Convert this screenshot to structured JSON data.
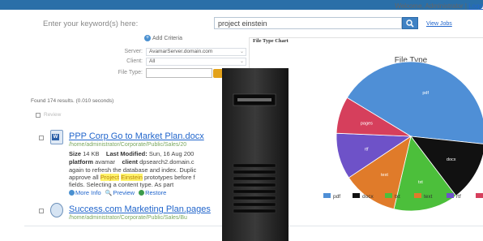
{
  "header": {
    "welcome_text": "Welcome, Administrator |",
    "logout_text": "Logo"
  },
  "search": {
    "label": "Enter your keyword(s) here:",
    "value": "project einstein",
    "view_jobs": "View Jobs",
    "add_criteria": "Add Criteria"
  },
  "criteria": {
    "server_label": "Server:",
    "server_value": "AvamarServer.domain.com",
    "client_label": "Client:",
    "client_value": "All",
    "file_type_label": "File Type:"
  },
  "results": {
    "found_text": "Found 174 results. (0.010 seconds)",
    "review_label": "Review"
  },
  "result1": {
    "title": "PPP Corp Go to Market Plan.docx",
    "path": "/home/administrator/Corporate/Public/Sales/20",
    "size_label": "Size",
    "size_value": "14 KB",
    "modified_label": "Last Modified:",
    "modified_value": "Sun, 16 Aug 200",
    "platform_label": "platform",
    "platform_value": "avamar",
    "client_label": "client",
    "client_value": "dpsearch2.domain.c",
    "snippet_1": "again to refresh the database and index. Duplic",
    "snippet_2_pre": "approve all ",
    "snippet_2_hl1": "Project",
    "snippet_2_hl2": "Einstein",
    "snippet_2_post": " prototypes before f",
    "snippet_3": "fields. Selecting a content type. As part",
    "more_info": "More Info",
    "preview": "Preview",
    "restore": "Restore"
  },
  "result2": {
    "title": "Success.com Marketing Plan.pages",
    "path": "/home/administrator/Corporate/Public/Sales/Bu"
  },
  "chart_panel": {
    "header": "File Type Chart"
  },
  "chart_data": {
    "type": "pie",
    "title": "File Type",
    "slices": [
      {
        "label": "pdf",
        "value": 43,
        "color": "#4f8fd6"
      },
      {
        "label": "docx",
        "value": 13,
        "color": "#111111"
      },
      {
        "label": "txt",
        "value": 14,
        "color": "#4cbf3b"
      },
      {
        "label": "text",
        "value": 12,
        "color": "#e07b2a"
      },
      {
        "label": "rtf",
        "value": 10,
        "color": "#6e52c8"
      },
      {
        "label": "pages",
        "value": 8,
        "color": "#d63f5c"
      }
    ],
    "legend_position": "bottom"
  }
}
